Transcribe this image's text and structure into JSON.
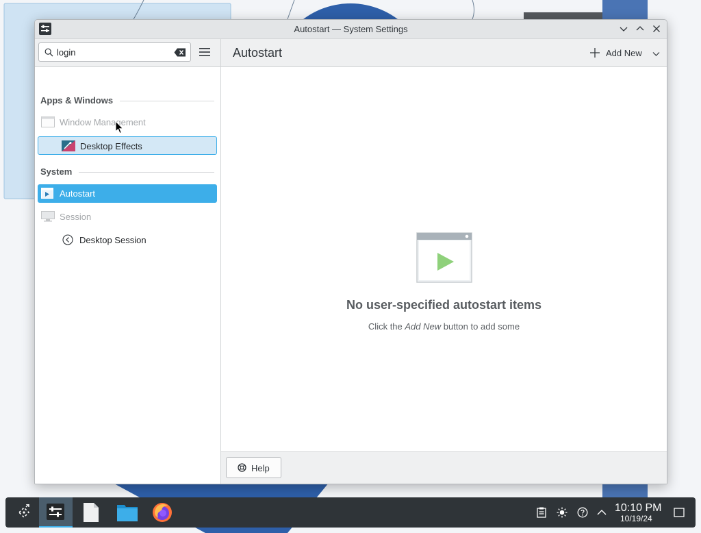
{
  "window": {
    "title": "Autostart — System Settings"
  },
  "sidebar": {
    "search": {
      "value": "login",
      "placeholder": "Search…"
    },
    "sections": [
      {
        "label": "Apps & Windows",
        "items": [
          {
            "label": "Window Management",
            "icon": "window-management-icon",
            "state": "disabled"
          },
          {
            "label": "Desktop Effects",
            "icon": "desktop-effects-icon",
            "state": "hovered"
          }
        ]
      },
      {
        "label": "System",
        "items": [
          {
            "label": "Autostart",
            "icon": "autostart-icon",
            "state": "selected"
          },
          {
            "label": "Session",
            "icon": "session-icon",
            "state": "disabled"
          },
          {
            "label": "Desktop Session",
            "icon": "back-arrow-icon",
            "state": "normal"
          }
        ]
      }
    ]
  },
  "main": {
    "title": "Autostart",
    "add_new_label": "Add New",
    "empty": {
      "title": "No user-specified autostart items",
      "sub_before": "Click the ",
      "sub_em": "Add New",
      "sub_after": " button to add some"
    },
    "help_label": "Help"
  },
  "taskbar": {
    "launchers": [
      "app-launcher-icon",
      "system-settings-icon",
      "text-editor-icon",
      "file-manager-icon",
      "firefox-icon"
    ],
    "tray": [
      "clipboard-icon",
      "brightness-icon",
      "help-tray-icon",
      "expand-tray-icon"
    ],
    "clock": {
      "time": "10:10 PM",
      "date": "10/19/24"
    }
  },
  "colors": {
    "accent": "#3daee9",
    "hover_bg": "#d4e8f6",
    "taskbar_bg": "#2f3438"
  }
}
